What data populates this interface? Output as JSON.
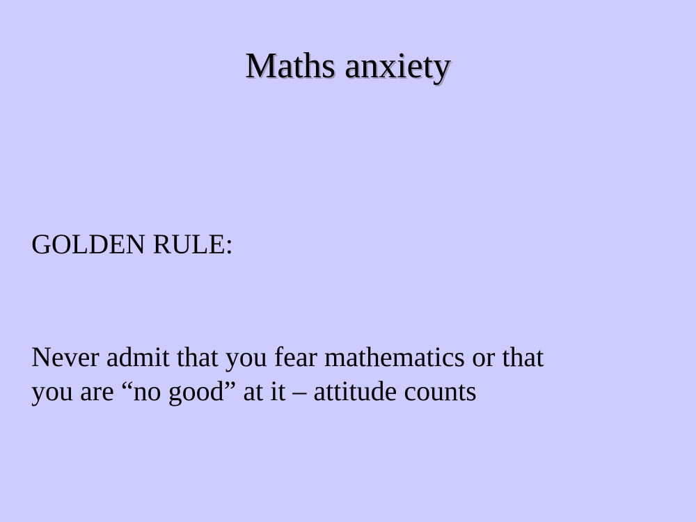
{
  "slide": {
    "background": "#CCCCFF",
    "title": "Maths anxiety",
    "heading": "GOLDEN RULE:",
    "body_lines": [
      "Never admit that you fear mathematics or that",
      "you are “no good” at it – attitude counts"
    ]
  }
}
